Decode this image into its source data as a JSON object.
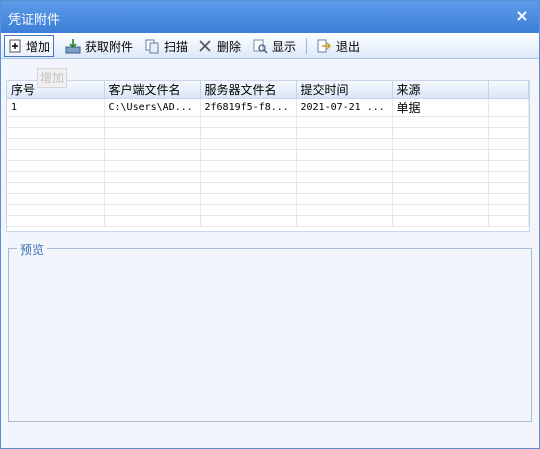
{
  "window": {
    "title": "凭证附件",
    "close_glyph": "×"
  },
  "toolbar": {
    "items": [
      {
        "label": "增加",
        "icon": "add-icon"
      },
      {
        "label": "获取附件",
        "icon": "get-attachment-icon"
      },
      {
        "label": "扫描",
        "icon": "scan-icon"
      },
      {
        "label": "删除",
        "icon": "delete-icon"
      },
      {
        "label": "显示",
        "icon": "display-icon"
      },
      {
        "label": "退出",
        "icon": "exit-icon"
      }
    ]
  },
  "tooltip": {
    "text": "增加"
  },
  "grid": {
    "columns": [
      "序号",
      "客户端文件名",
      "服务器文件名",
      "提交时间",
      "来源"
    ],
    "rows": [
      [
        "1",
        "C:\\Users\\AD...",
        "2f6819f5-f8...",
        "2021-07-21 ...",
        "单据"
      ]
    ]
  },
  "preview": {
    "legend": "预览"
  },
  "colors": {
    "titlebar": "#3d7fd8",
    "accent": "#4b76b8",
    "legend": "#3d6fb4"
  }
}
